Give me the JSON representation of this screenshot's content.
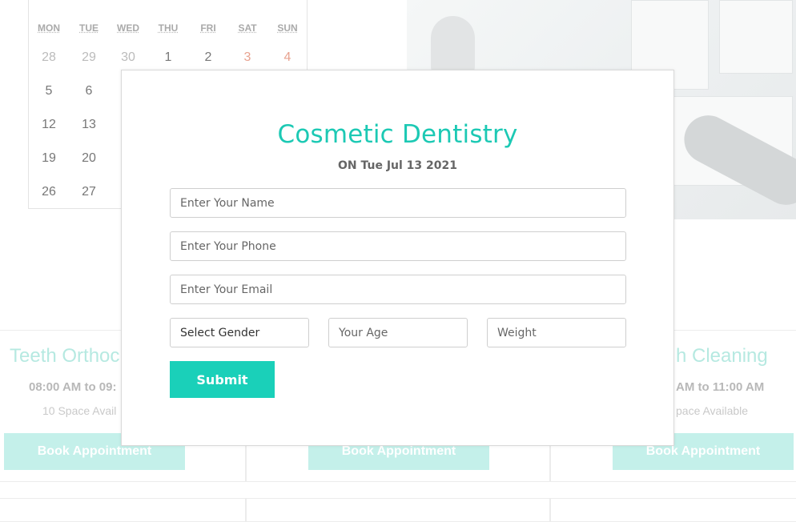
{
  "calendar": {
    "weekdays": [
      "MON",
      "TUE",
      "WED",
      "THU",
      "FRI",
      "SAT",
      "SUN"
    ],
    "rows": [
      [
        "28",
        "29",
        "30",
        "1",
        "2",
        "3",
        "4"
      ],
      [
        "5",
        "6"
      ],
      [
        "12",
        "13"
      ],
      [
        "19",
        "20"
      ],
      [
        "26",
        "27"
      ]
    ]
  },
  "cards": [
    {
      "title": "Teeth Orthoc",
      "time": "08:00 AM to 09:",
      "space": "10 Space Avail",
      "button": "Book Appointment"
    },
    {
      "title": "",
      "time": "",
      "space": "",
      "button": "Book Appointment"
    },
    {
      "title": "h Cleaning",
      "time": "AM to 11:00 AM",
      "space": "pace Available",
      "button": "Book Appointment"
    }
  ],
  "modal": {
    "title": "Cosmetic Dentistry",
    "date": "ON Tue Jul 13 2021",
    "name_placeholder": "Enter Your Name",
    "phone_placeholder": "Enter Your Phone",
    "email_placeholder": "Enter Your Email",
    "gender_selected": "Select Gender",
    "age_placeholder": "Your Age",
    "weight_placeholder": "Weight",
    "submit_label": "Submit"
  },
  "colors": {
    "accent": "#1ad0b9",
    "title": "#1cc9b4",
    "faded_accent": "#c4f0ea"
  }
}
